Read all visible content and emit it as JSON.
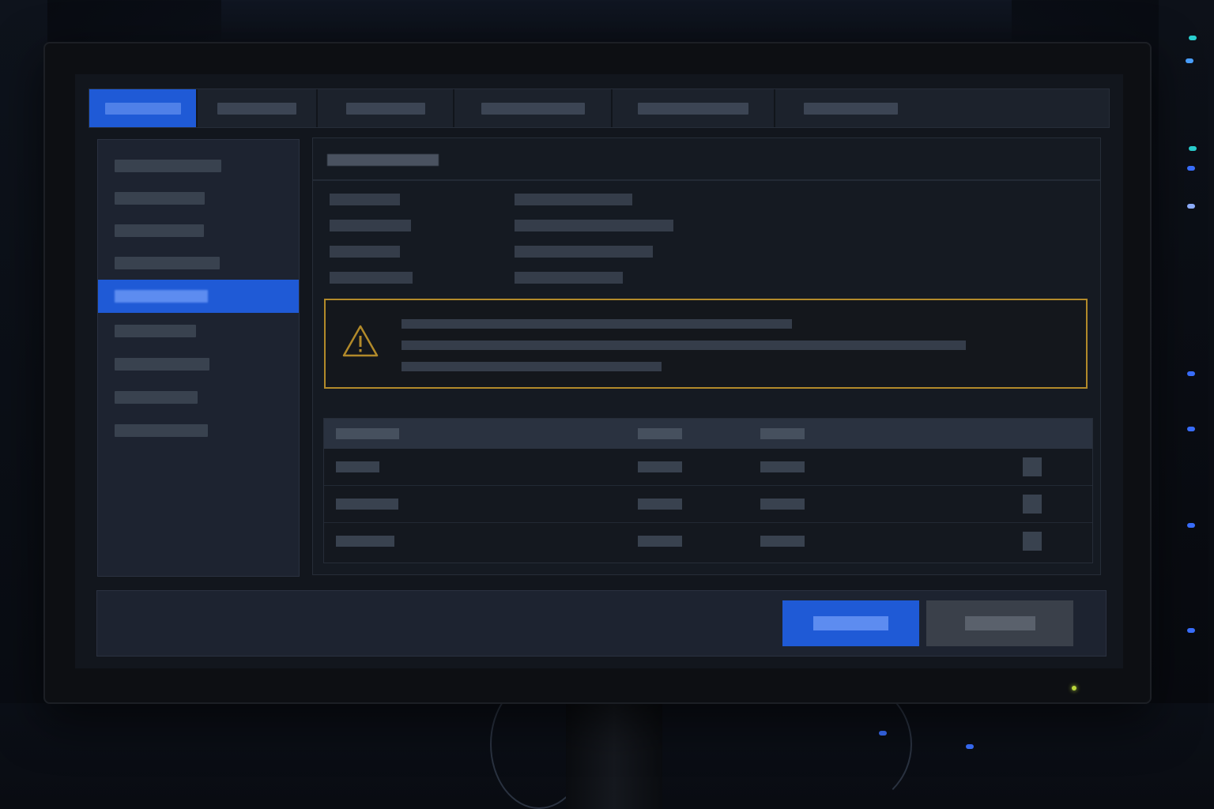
{
  "tabs": [
    {
      "label": ""
    },
    {
      "label": ""
    },
    {
      "label": ""
    },
    {
      "label": ""
    },
    {
      "label": ""
    },
    {
      "label": ""
    }
  ],
  "sidebar": {
    "items": [
      {
        "label": ""
      },
      {
        "label": ""
      },
      {
        "label": ""
      },
      {
        "label": ""
      },
      {
        "label": ""
      },
      {
        "label": ""
      },
      {
        "label": ""
      },
      {
        "label": ""
      },
      {
        "label": ""
      }
    ],
    "active_index": 4
  },
  "main": {
    "title": "",
    "fields": [
      {
        "label": "",
        "value": ""
      },
      {
        "label": "",
        "value": ""
      },
      {
        "label": "",
        "value": ""
      },
      {
        "label": "",
        "value": ""
      }
    ]
  },
  "alert": {
    "icon": "warning-triangle-icon",
    "lines": [
      "",
      "",
      ""
    ],
    "color": "#b28a2a"
  },
  "table": {
    "headers": [
      "",
      "",
      ""
    ],
    "rows": [
      [
        "",
        "",
        ""
      ],
      [
        "",
        "",
        ""
      ],
      [
        "",
        "",
        ""
      ]
    ]
  },
  "footer": {
    "primary_label": "",
    "secondary_label": ""
  },
  "colors": {
    "accent": "#1f5ad6",
    "warning": "#b28a2a",
    "screen_bg": "#12161d"
  }
}
